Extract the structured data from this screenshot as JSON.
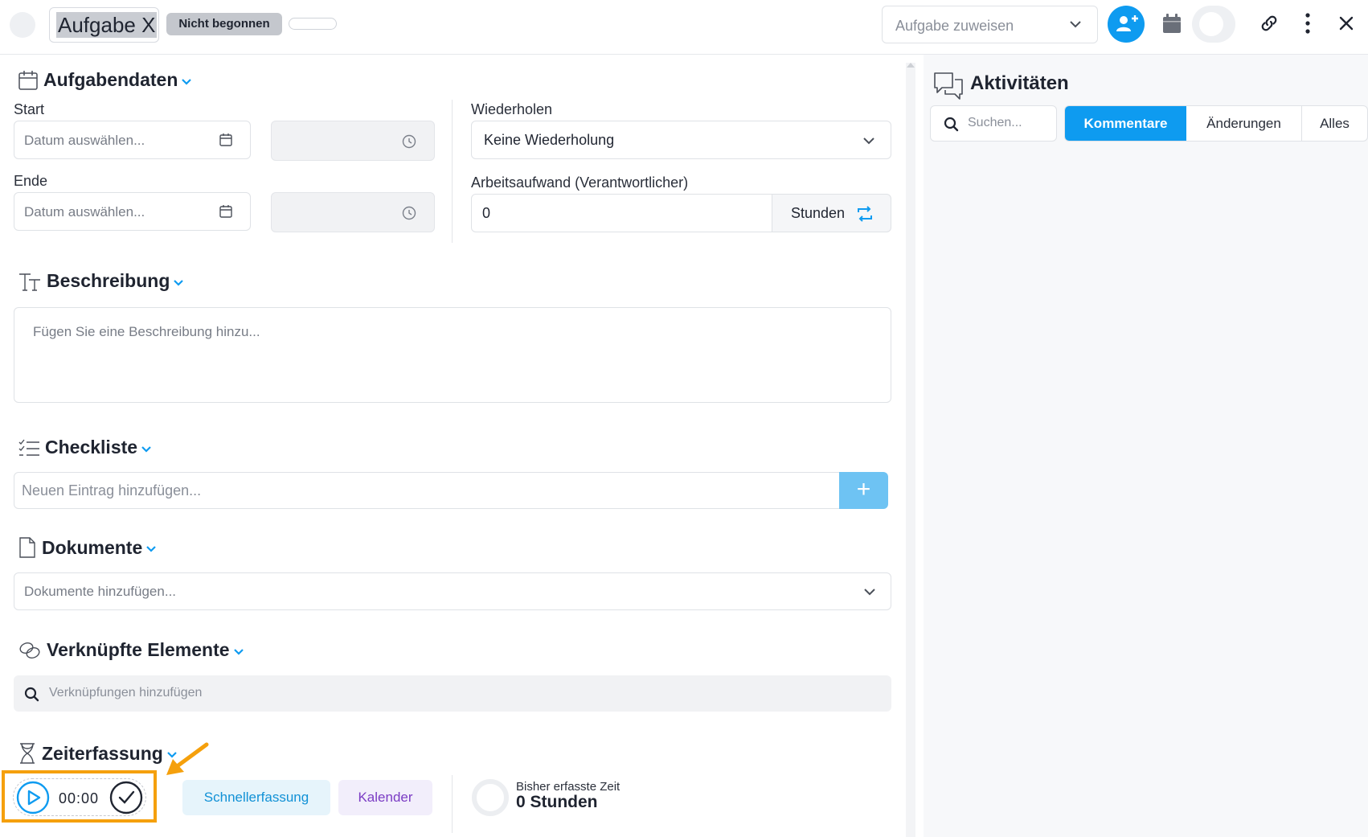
{
  "header": {
    "title": "Aufgabe X",
    "status": "Nicht begonnen",
    "assign_placeholder": "Aufgabe zuweisen"
  },
  "task_data": {
    "title": "Aufgabendaten",
    "start_label": "Start",
    "end_label": "Ende",
    "date_placeholder": "Datum auswählen...",
    "repeat_label": "Wiederholen",
    "repeat_value": "Keine Wiederholung",
    "effort_label": "Arbeitsaufwand (Verantwortlicher)",
    "effort_value": "0",
    "effort_unit": "Stunden"
  },
  "description": {
    "title": "Beschreibung",
    "placeholder": "Fügen Sie eine Beschreibung hinzu..."
  },
  "checklist": {
    "title": "Checkliste",
    "placeholder": "Neuen Eintrag hinzufügen...",
    "add_label": "+"
  },
  "documents": {
    "title": "Dokumente",
    "placeholder": "Dokumente hinzufügen..."
  },
  "linked": {
    "title": "Verknüpfte Elemente",
    "placeholder": "Verknüpfungen hinzufügen"
  },
  "time_tracking": {
    "title": "Zeiterfassung",
    "timer": "00:00",
    "quick_label": "Schnellerfassung",
    "calendar_label": "Kalender",
    "tracked_label": "Bisher erfasste Zeit",
    "tracked_value": "0 Stunden"
  },
  "activities": {
    "title": "Aktivitäten",
    "search_placeholder": "Suchen...",
    "tabs": [
      "Kommentare",
      "Änderungen",
      "Alles"
    ],
    "active_tab": "Kommentare"
  },
  "colors": {
    "accent": "#0e9bf0",
    "highlight": "#f5a00c",
    "calendar_purple": "#7b3cc4"
  }
}
